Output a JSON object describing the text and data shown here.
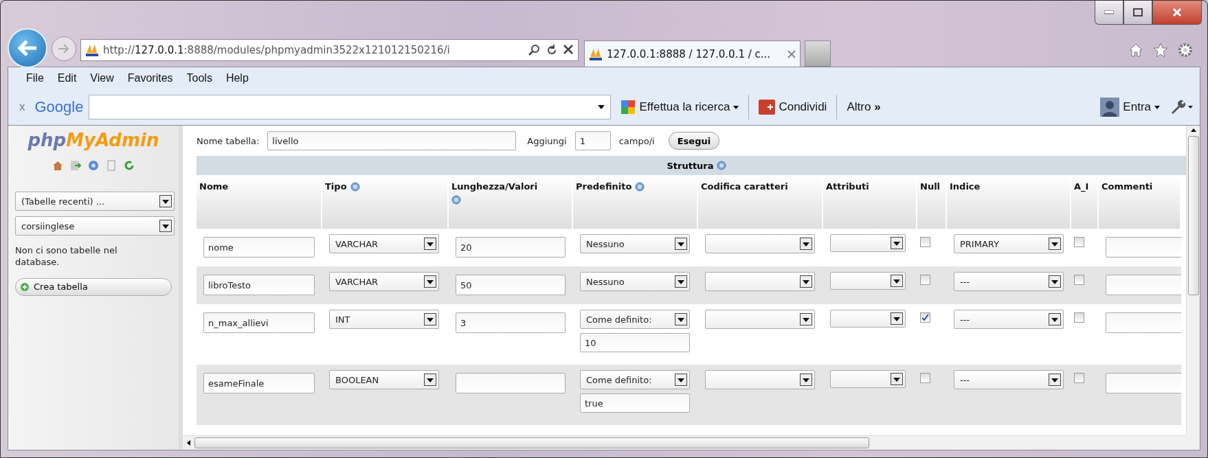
{
  "browser": {
    "address": "http://**127.0.0.1**:8888/modules/phpmyadmin3522x121012150216/i",
    "tabs": [
      {
        "title": "127.0.0.1:8888 / 127.0.0.1 / c...",
        "selected": true
      }
    ],
    "menu": [
      "File",
      "Edit",
      "View",
      "Favorites",
      "Tools",
      "Help"
    ],
    "google_bar": {
      "close": "x",
      "logo": "Google",
      "search_button": "Effettua la ricerca",
      "share": "Condividi",
      "more": "Altro",
      "more_glyph": "»",
      "sign_in": "Entra"
    }
  },
  "sidebar": {
    "logo_a": "php",
    "logo_b": "MyAdmin",
    "selects": [
      "(Tabelle recenti) ...",
      "corsiinglese"
    ],
    "message": "Non ci sono tabelle nel database.",
    "create_button": "Crea tabella"
  },
  "form": {
    "table_name_label": "Nome tabella:",
    "table_name": "livello",
    "add_label": "Aggiungi",
    "add_count": "1",
    "add_unit": "campo/i",
    "go_button": "Esegui"
  },
  "table": {
    "group_title": "Struttura",
    "columns": [
      {
        "label": "Nome",
        "help": false
      },
      {
        "label": "Tipo",
        "help": true
      },
      {
        "label": "Lunghezza/Valori",
        "help": true
      },
      {
        "label": "Predefinito",
        "help": true
      },
      {
        "label": "Codifica caratteri",
        "help": false
      },
      {
        "label": "Attributi",
        "help": false
      },
      {
        "label": "Null",
        "help": false
      },
      {
        "label": "Indice",
        "help": false
      },
      {
        "label": "A_I",
        "help": false
      },
      {
        "label": "Commenti",
        "help": false
      }
    ],
    "rows": [
      {
        "name": "nome",
        "type": "VARCHAR",
        "length": "20",
        "default": "Nessuno",
        "index": "PRIMARY",
        "null": false,
        "ai": false
      },
      {
        "name": "libroTesto",
        "type": "VARCHAR",
        "length": "50",
        "default": "Nessuno",
        "index": "---",
        "null": false,
        "ai": false
      },
      {
        "name": "n_max_allievi",
        "type": "INT",
        "length": "3",
        "default": "Come definito:",
        "default_value": "10",
        "index": "---",
        "null": true,
        "ai": false
      },
      {
        "name": "esameFinale",
        "type": "BOOLEAN",
        "default": "Come definito:",
        "default_value": "true",
        "index": "---",
        "null": false,
        "ai": false
      }
    ]
  }
}
